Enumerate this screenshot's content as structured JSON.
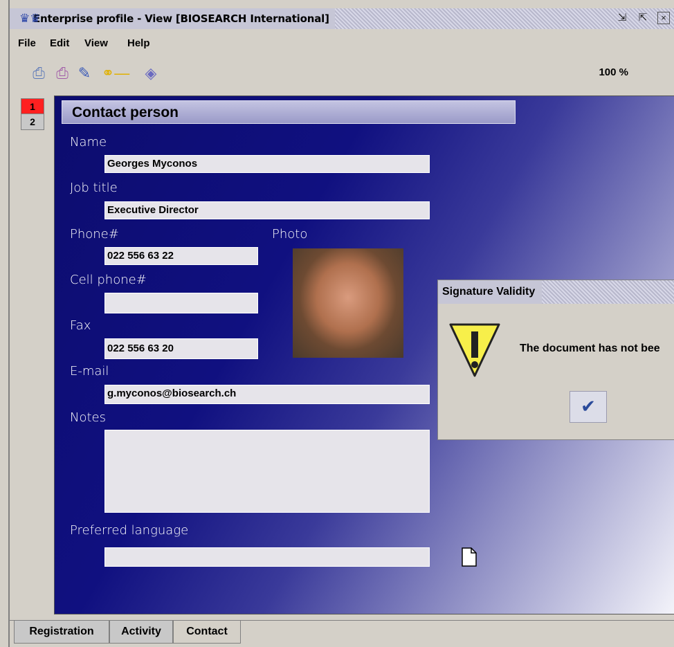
{
  "window": {
    "title": "Enterprise profile - View [BIOSEARCH International]",
    "app_icon": "people-icon",
    "controls": [
      "minimize-icon",
      "maximize-icon",
      "close-icon"
    ]
  },
  "menubar": [
    "File",
    "Edit",
    "View",
    "Help"
  ],
  "toolbar": {
    "icons": [
      "print-icon",
      "print-preview-icon",
      "sign-icon",
      "key-icon",
      "certificate-icon"
    ],
    "zoom": "100 %"
  },
  "side_tabs": [
    {
      "label": "1",
      "active": true,
      "color": "#ff0000"
    },
    {
      "label": "2",
      "active": false,
      "color": "#c0c0c0"
    }
  ],
  "form": {
    "header": "Contact person",
    "name_label": "Name",
    "name_value": "Georges Myconos",
    "job_label": "Job title",
    "job_value": "Executive Director",
    "phone_label": "Phone#",
    "phone_value": "022 556 63 22",
    "photo_label": "Photo",
    "cell_label": "Cell phone#",
    "cell_value": "",
    "fax_label": "Fax",
    "fax_value": "022 556 63 20",
    "email_label": "E-mail",
    "email_value": "g.myconos@biosearch.ch",
    "notes_label": "Notes",
    "notes_value": "",
    "language_label": "Preferred language",
    "language_value": ""
  },
  "bottom_tabs": [
    {
      "label": "Registration",
      "active": false
    },
    {
      "label": "Activity",
      "active": false
    },
    {
      "label": "Contact",
      "active": true
    }
  ],
  "dialog": {
    "title": "Signature Validity",
    "message": "The document has not bee",
    "icon": "warning-icon",
    "ok_icon": "checkmark-icon"
  },
  "colors": {
    "panel_dark": "#0c0c6e",
    "panel_light": "#f4f4fa",
    "active_tab": "#ff0000"
  }
}
